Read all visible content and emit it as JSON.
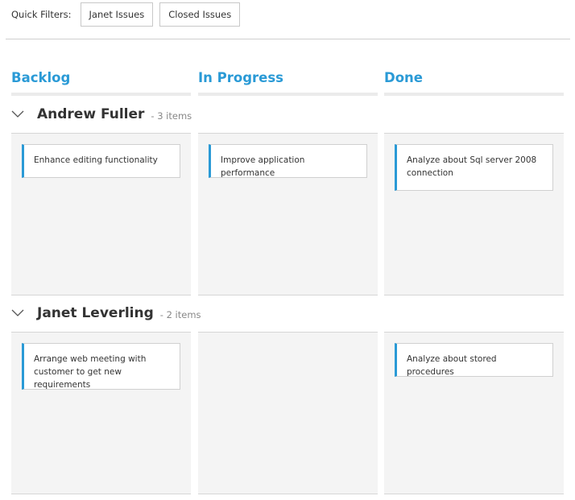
{
  "quick_filters": {
    "label": "Quick Filters:",
    "buttons": [
      "Janet Issues",
      "Closed Issues"
    ]
  },
  "columns": [
    "Backlog",
    "In Progress",
    "Done"
  ],
  "swimlanes": [
    {
      "name": "Andrew Fuller",
      "count": "- 3 items",
      "cards": {
        "backlog": "Enhance editing functionality",
        "in_progress": "Improve application performance",
        "done": "Analyze about Sql server 2008 connection"
      }
    },
    {
      "name": "Janet Leverling",
      "count": "- 2 items",
      "cards": {
        "backlog": "Arrange web meeting with customer to get new requirements",
        "done": "Analyze about stored procedures"
      }
    }
  ],
  "colors": {
    "accent": "#2a9ad6",
    "cell_bg": "#f4f4f4"
  },
  "icons": {
    "expand": "chevron-down-icon"
  }
}
